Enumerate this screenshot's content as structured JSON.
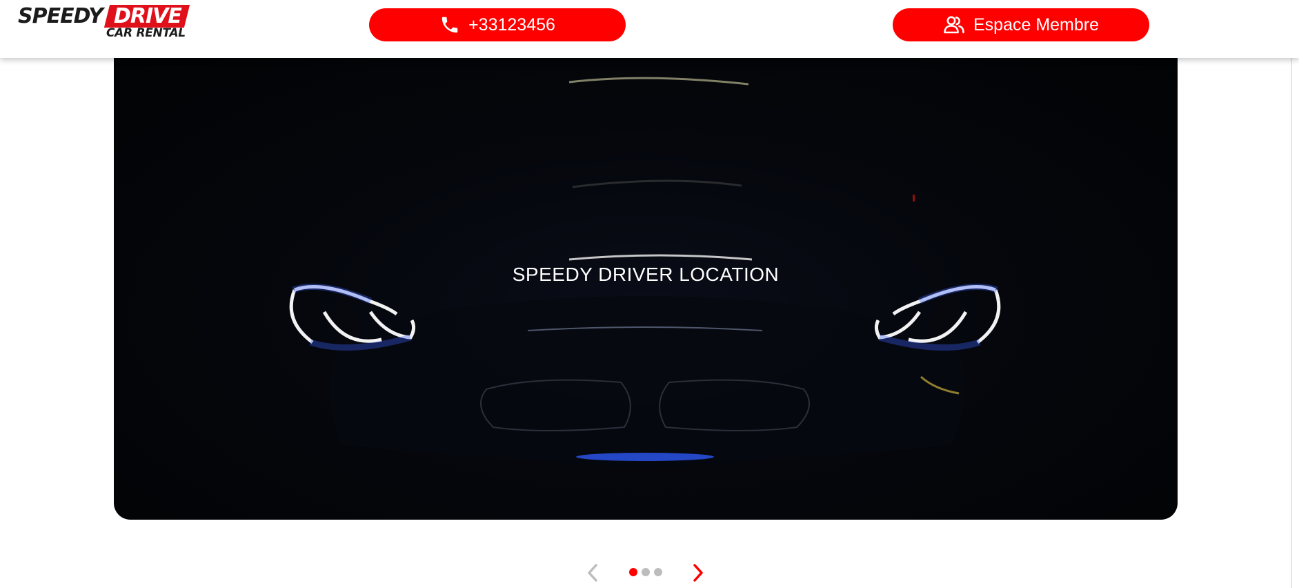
{
  "header": {
    "logo": {
      "word1": "SPEEDY",
      "word2": "DRIVE",
      "tagline": "CAR RENTAL"
    },
    "phone_button": {
      "label": "+33123456",
      "icon": "phone-icon"
    },
    "member_button": {
      "label": "Espace Membre",
      "icon": "users-icon"
    }
  },
  "hero": {
    "title": "SPEEDY DRIVER LOCATION"
  },
  "carousel": {
    "prev_icon": "chevron-left-icon",
    "next_icon": "chevron-right-icon",
    "slide_count": 3,
    "active_slide": 1
  },
  "colors": {
    "brand_red": "#ff0000",
    "logo_red": "#e0101b",
    "inactive_dot": "#bdbdbd",
    "hero_background": "#05070d"
  }
}
